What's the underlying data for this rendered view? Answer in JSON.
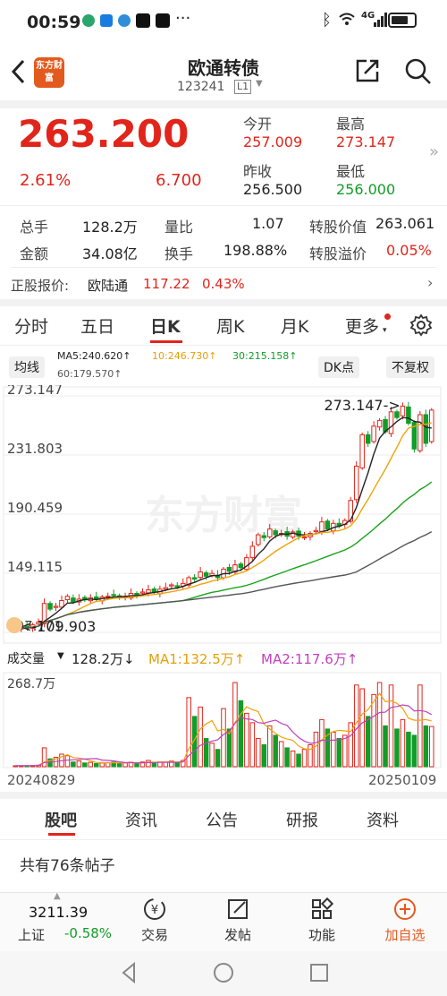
{
  "status_bar": {
    "time": "00:59",
    "signal": "4G",
    "battery": "84"
  },
  "header": {
    "title": "欧通转债",
    "code": "123241",
    "level_badge": "L1",
    "logo_text": "东方财富"
  },
  "quote": {
    "price": "263.200",
    "change_pct": "2.61%",
    "change_abs": "6.700",
    "open_label": "今开",
    "open": "257.009",
    "high_label": "最高",
    "high": "273.147",
    "prev_close_label": "昨收",
    "prev_close": "256.500",
    "low_label": "最低",
    "low": "256.000"
  },
  "stats": {
    "volume_label": "总手",
    "volume": "128.2万",
    "vol_ratio_label": "量比",
    "vol_ratio": "1.07",
    "conv_value_label": "转股价值",
    "conv_value": "263.061",
    "amount_label": "金额",
    "amount": "34.08亿",
    "turnover_label": "换手",
    "turnover": "198.88%",
    "premium_label": "转股溢价",
    "premium": "0.05%"
  },
  "stock_quote": {
    "label": "正股报价:",
    "name": "欧陆通",
    "price": "117.22",
    "change": "0.43%"
  },
  "chart_tabs": [
    "分时",
    "五日",
    "日K",
    "周K",
    "月K",
    "更多"
  ],
  "chart_controls": {
    "ma_button": "均线",
    "ma5": "MA5:240.620↑",
    "ma10": "10:246.730↑",
    "ma30": "30:215.158↑",
    "ma60": "60:179.570↑",
    "dk_button": "DK点",
    "adjust_button": "不复权"
  },
  "colors": {
    "up": "#e1251b",
    "down": "#119d28",
    "ma5": "#222222",
    "ma10": "#f0a30a",
    "ma30": "#1aa31a",
    "ma60": "#555555",
    "vol_ma2": "#c040c0",
    "accent": "#e1251b"
  },
  "chart_data": {
    "type": "candlestick",
    "ylim": [
      107.771,
      273.147
    ],
    "y_ticks": [
      "273.147",
      "231.803",
      "190.459",
      "149.115",
      "107.771"
    ],
    "max_label": "273.147->",
    "min_label": "109.903",
    "x_start": "20240829",
    "x_end": "20250109",
    "close": [
      110.5,
      110.8,
      111.2,
      113,
      115,
      128,
      124,
      126,
      130,
      133,
      129,
      131,
      130.5,
      132,
      131,
      132.5,
      133,
      134,
      132,
      133,
      135,
      134,
      136,
      137.5,
      136,
      138,
      139,
      141,
      139.5,
      142,
      146,
      145,
      150,
      147,
      149,
      146,
      152,
      150.5,
      155,
      153,
      160,
      168,
      176,
      174,
      180,
      176,
      177,
      175,
      178,
      175,
      174.5,
      177,
      179,
      185,
      180,
      184,
      182,
      186,
      200,
      224,
      246,
      240,
      252,
      256,
      248,
      262,
      258,
      266,
      254,
      236,
      260,
      240,
      263.2
    ],
    "volume_unit": "万",
    "volume_max_label": "268.7万",
    "volume": [
      3,
      3,
      3,
      4,
      5,
      60,
      25,
      30,
      40,
      35,
      15,
      18,
      12,
      14,
      10,
      12,
      13,
      15,
      10,
      12,
      14,
      10,
      15,
      20,
      12,
      15,
      15,
      18,
      12,
      20,
      220,
      160,
      190,
      90,
      75,
      55,
      185,
      120,
      268,
      210,
      170,
      140,
      90,
      70,
      130,
      100,
      80,
      60,
      50,
      40,
      55,
      70,
      110,
      150,
      120,
      110,
      90,
      100,
      140,
      260,
      248,
      160,
      230,
      268,
      130,
      260,
      120,
      150,
      110,
      100,
      260,
      130,
      128
    ],
    "volume_legend": {
      "label": "成交量",
      "value": "128.2万↓",
      "ma1": "MA1:132.5万↑",
      "ma2": "MA2:117.6万↑"
    }
  },
  "watermark": "东方财富",
  "bottom_tabs": [
    "股吧",
    "资讯",
    "公告",
    "研报",
    "资料"
  ],
  "posts_text": "共有76条帖子",
  "dock": {
    "index_value": "3211.39",
    "index_name": "上证",
    "index_change": "-0.58%",
    "items": [
      "交易",
      "发帖",
      "功能",
      "加自选"
    ]
  }
}
